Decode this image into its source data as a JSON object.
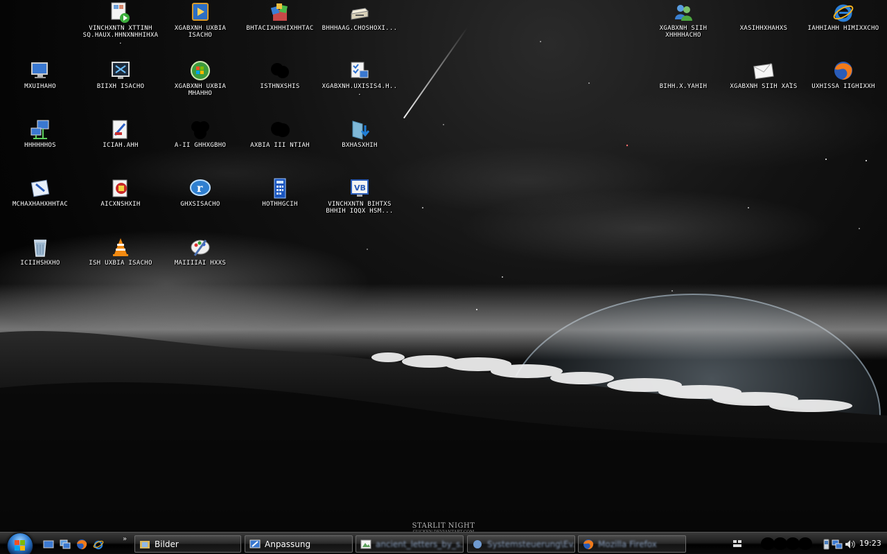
{
  "wallpaper": {
    "watermark_title": "STARLIT NIGHT",
    "watermark_credit": "GUCKEN.DEVIANTART.COM"
  },
  "desktop_icons": [
    {
      "label": "VINCHXNTN XTTINH SQ.HAUX.HHNXNHHIHXA.",
      "icon": "video-player-icon"
    },
    {
      "label": "XGABXNH UXBIA ISACHO",
      "icon": "media-center-icon"
    },
    {
      "label": "BHTACIXHHHIXHHTAC",
      "icon": "installer-icon"
    },
    {
      "label": "BHHHAAG.CHOSHOXI...",
      "icon": "scanner-icon"
    },
    {
      "label": "XGABXNH SIIH XHHHHACHO",
      "icon": "contacts-icon"
    },
    {
      "label": "XASIHHXHAHXS",
      "icon": "blank-icon"
    },
    {
      "label": "IAHHIAHH HIMIXXCHO",
      "icon": "internet-explorer-icon"
    },
    {
      "label": "MXUIHAHO",
      "icon": "computer-icon"
    },
    {
      "label": "BIIXH ISACHO",
      "icon": "remote-desktop-icon"
    },
    {
      "label": "XGABXNH UXBIA MHAHHO",
      "icon": "windows-media-icon"
    },
    {
      "label": "ISTHNXSHIS",
      "icon": "redacted-icon"
    },
    {
      "label": "XGABXNH.UXISIS4.H...",
      "icon": "control-panel-icon"
    },
    {
      "label": "BIHH.X.YAHIH",
      "icon": "blank-icon"
    },
    {
      "label": "XGABXNH SIIH XAIS",
      "icon": "mail-icon"
    },
    {
      "label": "UXHISSA IIGHIXXH",
      "icon": "firefox-icon"
    },
    {
      "label": "HHHHHHOS",
      "icon": "network-icon"
    },
    {
      "label": "ICIAH.AHH",
      "icon": "document-icon"
    },
    {
      "label": "A-II GHHXGBHO",
      "icon": "redacted-icon"
    },
    {
      "label": "AXBIA III NTIAH",
      "icon": "redacted-icon"
    },
    {
      "label": "BXHASXHIH",
      "icon": "download-folder-icon"
    },
    {
      "label": "MCHAXHAHXHHTAC",
      "icon": "notepad-icon"
    },
    {
      "label": "AICXNSHXIH",
      "icon": "security-tool-icon"
    },
    {
      "label": "GHXSISACHO",
      "icon": "realplayer-icon"
    },
    {
      "label": "HOTHHGCIH",
      "icon": "calculator-icon"
    },
    {
      "label": "VINCHXNTN BIHTXS BHHIH IQQX HSM...",
      "icon": "visual-basic-icon"
    },
    {
      "label": "ICIIHSHXHO",
      "icon": "recycle-bin-icon"
    },
    {
      "label": "ISH UXBIA ISACHO",
      "icon": "vlc-icon"
    },
    {
      "label": "MAIIIIAI HXXS",
      "icon": "paint-icon"
    }
  ],
  "taskbar": {
    "buttons": [
      {
        "label": "Bilder",
        "icon": "folder-icon",
        "blurred": false
      },
      {
        "label": "Anpassung",
        "icon": "personalize-icon",
        "blurred": false
      },
      {
        "label": "ancient_letters_by_s...",
        "icon": "image-icon",
        "blurred": true
      },
      {
        "label": "Systemsteuerung\\Ev...",
        "icon": "control-panel-icon",
        "blurred": true
      },
      {
        "label": "Mozilla Firefox",
        "icon": "firefox-icon",
        "blurred": true
      }
    ],
    "quick_launch_more": "»",
    "clock": "19:23",
    "tray_icons": [
      "language-bar-icon",
      "phone-icon",
      "network-icon",
      "volume-icon"
    ]
  }
}
